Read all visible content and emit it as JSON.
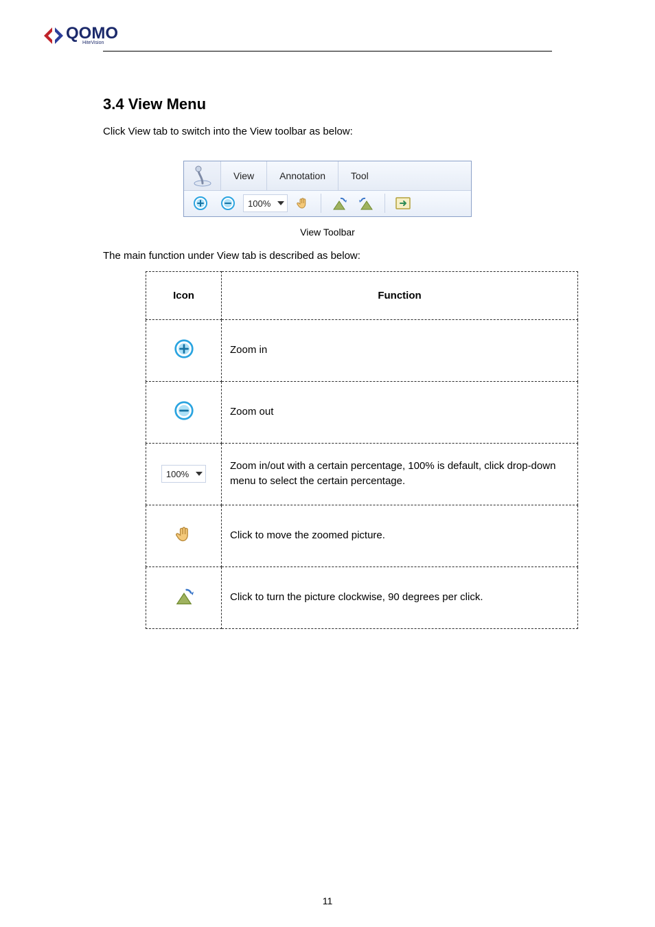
{
  "section": {
    "number": "3.4",
    "title": "View Menu"
  },
  "intro": "Click View tab to switch into the View toolbar as below:",
  "toolbar": {
    "tabs": {
      "view": "View",
      "annotation": "Annotation",
      "tool": "Tool"
    },
    "zoom_value": "100%"
  },
  "caption": "View Toolbar",
  "description": "The main function under View tab is described as below:",
  "table": {
    "headers": {
      "icon": "Icon",
      "function": "Function"
    },
    "rows": [
      {
        "fn": "Zoom in"
      },
      {
        "fn": "Zoom out"
      },
      {
        "fn": "Zoom in/out with a certain percentage, 100% is default, click drop-down menu to select the certain percentage."
      },
      {
        "fn": "Click to move the zoomed picture."
      },
      {
        "fn": "Click to turn the picture clockwise, 90 degrees per click."
      }
    ],
    "zoom_cell_value": "100%"
  },
  "page_number": "11"
}
